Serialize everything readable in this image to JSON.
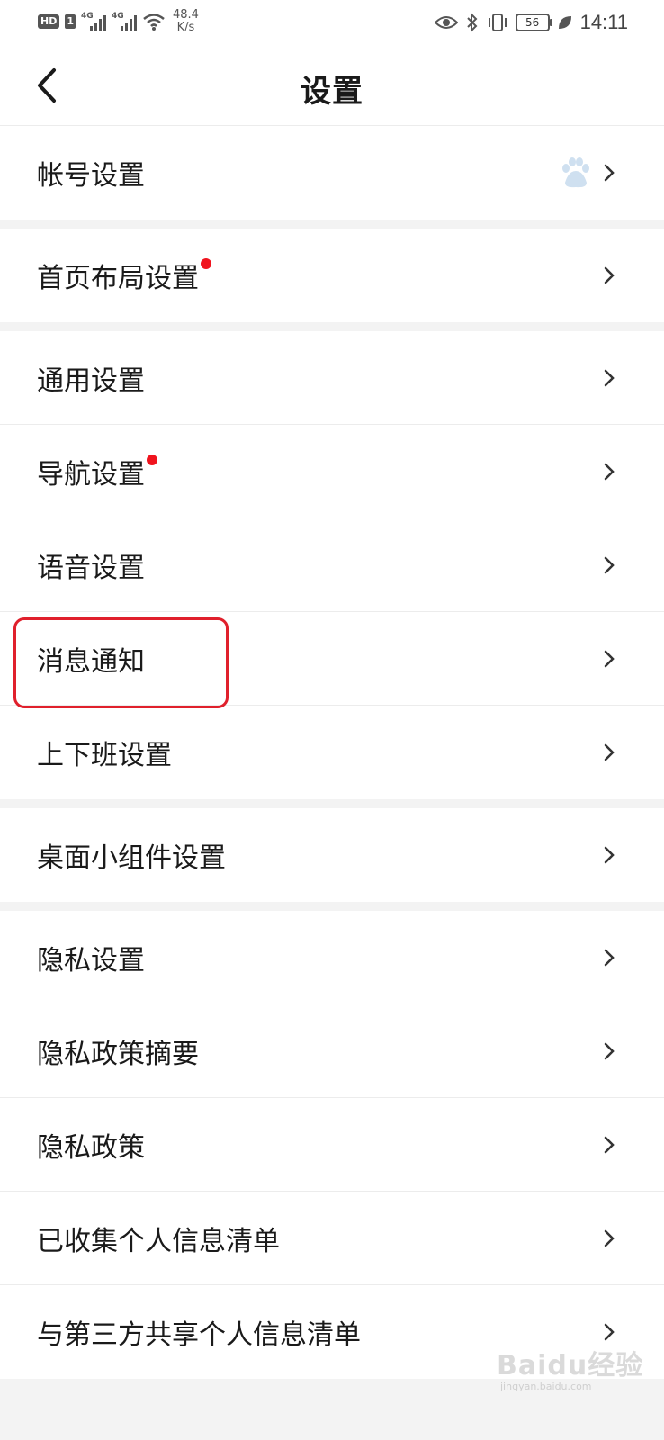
{
  "status_bar": {
    "hd_label": "HD",
    "sim_label": "1",
    "network_type_1": "4G",
    "network_type_2": "4G",
    "speed_value": "48.4",
    "speed_unit": "K/s",
    "battery_level": "56",
    "time": "14:11"
  },
  "header": {
    "title": "设置"
  },
  "settings": {
    "account": "帐号设置",
    "home_layout": "首页布局设置",
    "general": "通用设置",
    "navigation": "导航设置",
    "voice": "语音设置",
    "notifications": "消息通知",
    "commute": "上下班设置",
    "widget": "桌面小组件设置",
    "privacy": "隐私设置",
    "privacy_summary": "隐私政策摘要",
    "privacy_policy": "隐私政策",
    "collected_info": "已收集个人信息清单",
    "third_party_info": "与第三方共享个人信息清单"
  },
  "watermark": {
    "text": "Baidu经验",
    "sub": "jingyan.baidu.com"
  },
  "colors": {
    "accent_dot": "#f0141e",
    "highlight": "#e0202c",
    "background": "#f3f3f3"
  }
}
